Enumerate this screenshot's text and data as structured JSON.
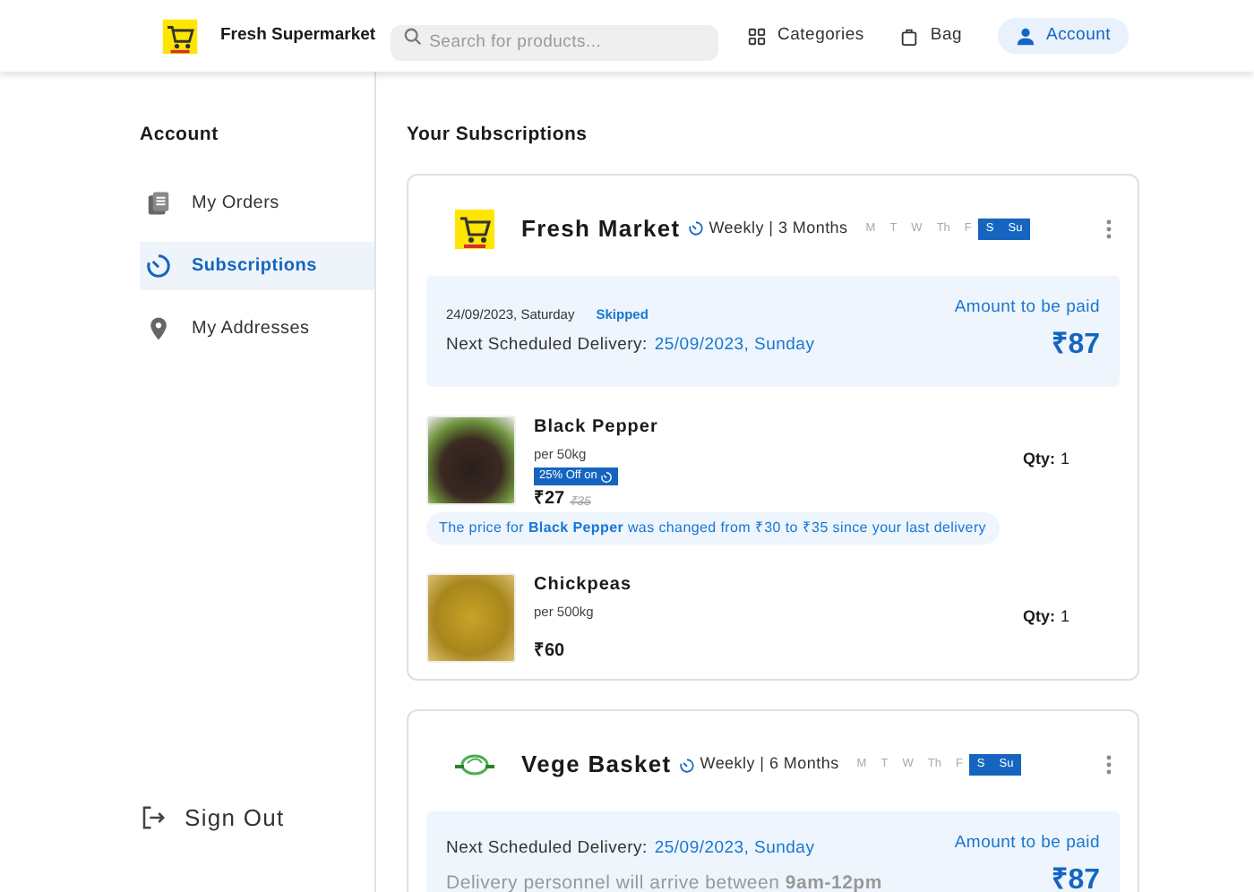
{
  "header": {
    "brand": "Fresh Supermarket",
    "search": {
      "placeholder": "Search for products..."
    },
    "nav": [
      {
        "label": "Categories",
        "selected": false
      },
      {
        "label": "Bag",
        "selected": false
      },
      {
        "label": "Account",
        "selected": true
      }
    ]
  },
  "sidebar": {
    "title": "Account",
    "items": [
      {
        "label": "My Orders",
        "selected": false
      },
      {
        "label": "Subscriptions",
        "selected": true
      },
      {
        "label": "My Addresses",
        "selected": false
      }
    ],
    "sign_out": "Sign Out"
  },
  "page_title": "Your Subscriptions",
  "subscriptions": [
    {
      "store": "Fresh Market",
      "plan": "Weekly | 3 Months",
      "days": [
        {
          "label": "M",
          "selected": false
        },
        {
          "label": "T",
          "selected": false
        },
        {
          "label": "W",
          "selected": false
        },
        {
          "label": "Th",
          "selected": false
        },
        {
          "label": "F",
          "selected": false
        },
        {
          "label": "S",
          "selected": true
        },
        {
          "label": "Su",
          "selected": true
        }
      ],
      "skipped_date": "24/09/2023, Saturday",
      "skipped_label": "Skipped",
      "next_label": "Next Scheduled Delivery:",
      "next_date": "25/09/2023, Sunday",
      "amount_label": "Amount to be paid",
      "amount": "₹87",
      "items": [
        {
          "name": "Black Pepper",
          "unit": "per 50kg",
          "badge": "25% Off on",
          "price": "₹27",
          "old_price": "₹35",
          "qty_label": "Qty:",
          "qty": "1",
          "notice": "The price for **Black Pepper** was changed from ₹30 to ₹35 since your last delivery"
        },
        {
          "name": "Chickpeas",
          "unit": "per 500kg",
          "price": "₹60",
          "qty_label": "Qty:",
          "qty": "1"
        }
      ]
    },
    {
      "store": "Vege Basket",
      "plan": "Weekly | 6 Months",
      "days": [
        {
          "label": "M",
          "selected": false
        },
        {
          "label": "T",
          "selected": false
        },
        {
          "label": "W",
          "selected": false
        },
        {
          "label": "Th",
          "selected": false
        },
        {
          "label": "F",
          "selected": false
        },
        {
          "label": "S",
          "selected": true
        },
        {
          "label": "Su",
          "selected": true
        }
      ],
      "next_label": "Next Scheduled Delivery:",
      "next_date": "25/09/2023, Sunday",
      "arrival": "Delivery personnel will arrive between **9am-12pm**",
      "amount_label": "Amount to be paid",
      "amount": "₹87"
    }
  ]
}
